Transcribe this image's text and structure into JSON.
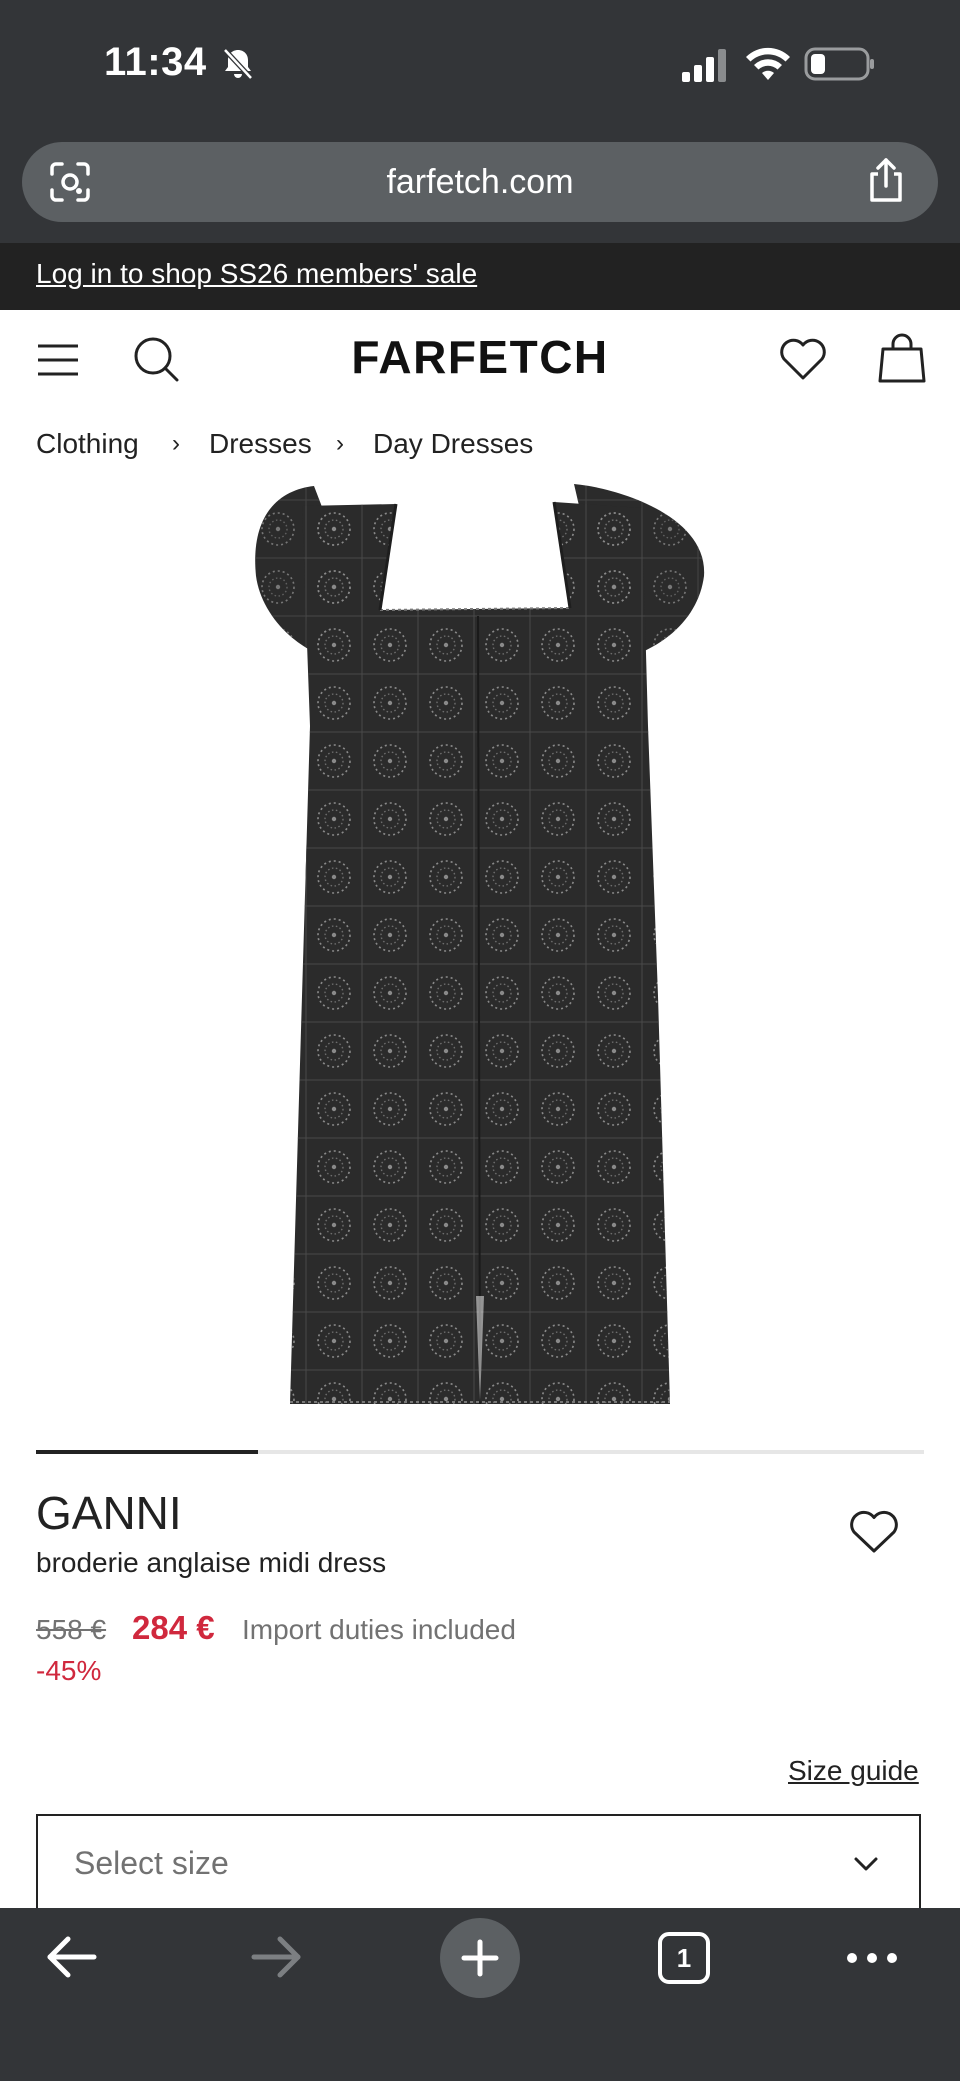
{
  "status_bar": {
    "time": "11:34",
    "icons": [
      "bell-slash-icon",
      "signal-icon",
      "wifi-icon",
      "battery-icon"
    ]
  },
  "browser": {
    "url": "farfetch.com",
    "icons": [
      "lens-icon",
      "share-icon"
    ],
    "toolbar": {
      "tab_count": "1",
      "icons": [
        "back-arrow-icon",
        "forward-arrow-icon",
        "plus-icon",
        "tabs-icon",
        "more-icon"
      ]
    }
  },
  "promo": {
    "text": "Log in to shop SS26 members' sale"
  },
  "header": {
    "logo": "FARFETCH",
    "icons": [
      "menu-icon",
      "search-icon",
      "heart-icon",
      "bag-icon"
    ]
  },
  "breadcrumb": {
    "items": [
      "Clothing",
      "Dresses",
      "Day Dresses"
    ],
    "separator": "›"
  },
  "gallery": {
    "progress": 0.25
  },
  "product": {
    "brand": "GANNI",
    "name": "broderie anglaise midi dress",
    "original_price": "558 €",
    "sale_price": "284 €",
    "duties_note": "Import duties included",
    "discount": "-45%",
    "size_guide_label": "Size guide",
    "size_select_placeholder": "Select size"
  },
  "colors": {
    "browser_chrome": "#333538",
    "pill": "#5c6063",
    "sale_red": "#d0283d",
    "muted_text": "#727272",
    "dress": "#2b2b2b"
  }
}
